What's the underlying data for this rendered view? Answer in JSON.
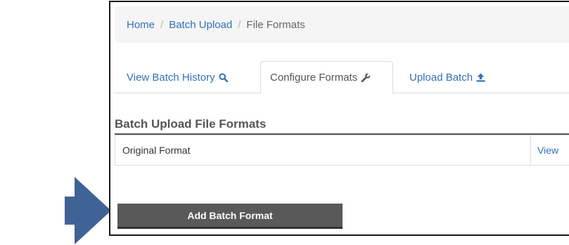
{
  "breadcrumb": {
    "items": [
      "Home",
      "Batch Upload",
      "File Formats"
    ],
    "separator": "/"
  },
  "tabs": {
    "history": {
      "label": "View Batch History",
      "icon": "search-icon"
    },
    "configure": {
      "label": "Configure Formats",
      "icon": "wrench-icon"
    },
    "upload": {
      "label": "Upload Batch",
      "icon": "upload-icon"
    }
  },
  "section": {
    "title": "Batch Upload File Formats"
  },
  "formats": [
    {
      "name": "Original Format",
      "action": "View"
    }
  ],
  "actions": {
    "add_label": "Add Batch Format"
  },
  "colors": {
    "link": "#3370b7",
    "arrow": "#3f6397",
    "button": "#595959",
    "breadcrumb_bg": "#f5f5f5"
  }
}
